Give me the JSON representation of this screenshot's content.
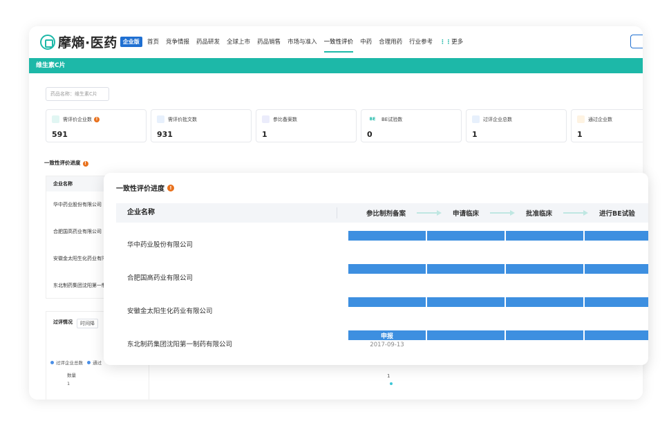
{
  "logo": {
    "name": "摩熵·医药",
    "badge": "企业版"
  },
  "nav": {
    "items": [
      "首页",
      "竞争情报",
      "药品研发",
      "全球上市",
      "药品销售",
      "市场与准入",
      "一致性评价",
      "中药",
      "合理用药",
      "行业参考"
    ],
    "more": "更多",
    "active_index": 6
  },
  "banner": {
    "title": "维生素C片"
  },
  "search": {
    "value": "药品名称：维生素C片"
  },
  "stats": [
    {
      "label": "需评价企业数",
      "value": "591",
      "icon": "tablet-icon",
      "color": "#1db8a8"
    },
    {
      "label": "需评价批文数",
      "value": "931",
      "icon": "document-icon",
      "color": "#4a8fe7"
    },
    {
      "label": "参比备案数",
      "value": "1",
      "icon": "shield-icon",
      "color": "#6b6fe0"
    },
    {
      "label": "BE试验数",
      "value": "0",
      "icon": "be-icon",
      "color": "#1db8a8"
    },
    {
      "label": "过评企业总数",
      "value": "1",
      "icon": "building-icon",
      "color": "#4a8fe7"
    },
    {
      "label": "通过企业数",
      "value": "1",
      "icon": "building-check-icon",
      "color": "#f5a623"
    }
  ],
  "section": {
    "title": "一致性评价进度"
  },
  "bg_table": {
    "header": "企业名称",
    "rows": [
      "华中药业股份有限公司",
      "合肥国高药业有限公司",
      "安徽金太阳生化药业有限公司",
      "东北制药集团沈阳第一制药有限公司"
    ]
  },
  "bg_chart": {
    "tabs": [
      "过评情况",
      "时间降"
    ],
    "legend": [
      "过评企业总数",
      "通过"
    ],
    "y_label": "数量",
    "y_tick": "1",
    "point_label": "1"
  },
  "float_panel": {
    "title": "一致性评价进度",
    "header_name": "企业名称",
    "stages": [
      "参比制剂备案",
      "申请临床",
      "批准临床",
      "进行BE试验"
    ],
    "rows": [
      {
        "name": "华中药业股份有限公司",
        "bar_label": "",
        "bar_date": ""
      },
      {
        "name": "合肥国高药业有限公司",
        "bar_label": "",
        "bar_date": ""
      },
      {
        "name": "安徽金太阳生化药业有限公司",
        "bar_label": "",
        "bar_date": ""
      },
      {
        "name": "东北制药集团沈阳第一制药有限公司",
        "bar_label": "申报",
        "bar_date": "2017-09-13"
      }
    ]
  },
  "colors": {
    "accent": "#1db8a8",
    "bar": "#3d8fe0",
    "brand_blue": "#1f6fd1",
    "info": "#e8711d"
  }
}
